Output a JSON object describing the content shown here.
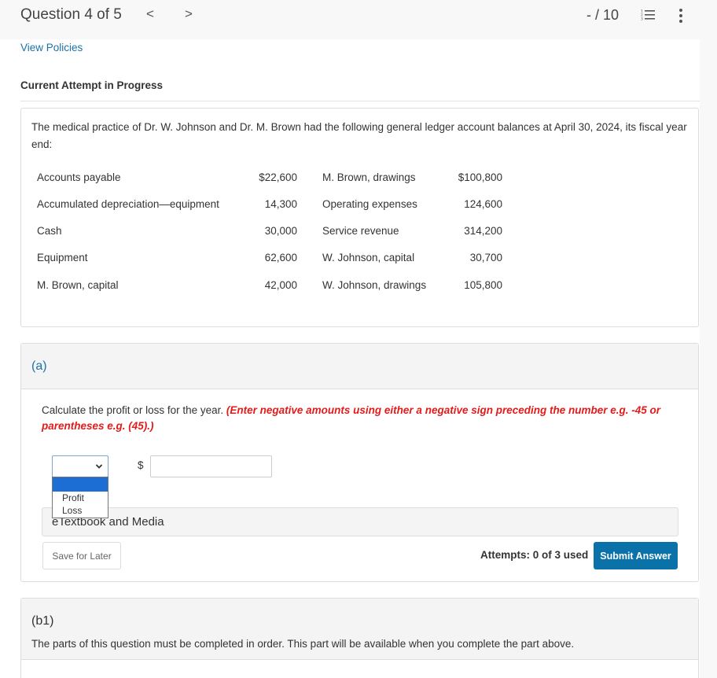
{
  "header": {
    "question_title": "Question 4 of 5",
    "prev_glyph": "<",
    "next_glyph": ">",
    "score": "- / 10",
    "icons": {
      "question_list": "numbered-list-icon",
      "more": "more-vertical-icon"
    }
  },
  "links": {
    "view_policies": "View Policies"
  },
  "attempt_heading": "Current Attempt in Progress",
  "problem": {
    "text": "The medical practice of Dr. W. Johnson and Dr. M. Brown had the following general ledger account balances at April 30, 2024, its fiscal year end:",
    "ledger": [
      {
        "name1": "Accounts payable",
        "amount1": "$22,600",
        "name2": "M. Brown, drawings",
        "amount2": "$100,800"
      },
      {
        "name1": "Accumulated depreciation—equipment",
        "amount1": "14,300",
        "name2": "Operating expenses",
        "amount2": "124,600"
      },
      {
        "name1": "Cash",
        "amount1": "30,000",
        "name2": "Service revenue",
        "amount2": "314,200"
      },
      {
        "name1": "Equipment",
        "amount1": "62,600",
        "name2": "W. Johnson, capital",
        "amount2": "30,700"
      },
      {
        "name1": "M. Brown, capital",
        "amount1": "42,000",
        "name2": "W. Johnson, drawings",
        "amount2": "105,800"
      }
    ]
  },
  "part_a": {
    "label": "(a)",
    "instruction": "Calculate the profit or loss for the year.",
    "instruction_note": "(Enter negative amounts using either a negative sign preceding the number e.g. -45 or parentheses e.g. (45).)",
    "select": {
      "selected": "",
      "options": [
        "",
        "Profit",
        "Loss"
      ]
    },
    "currency_symbol": "$",
    "amount_value": "",
    "etextbook_label": "eTextbook and Media",
    "save_label": "Save for Later",
    "attempts_text": "Attempts: 0 of 3 used",
    "submit_label": "Submit Answer"
  },
  "part_b1": {
    "label": "(b1)",
    "message": "The parts of this question must be completed in order. This part will be available when you complete the part above."
  },
  "colors": {
    "link_blue": "#1a73a8",
    "note_red": "#e21b1b",
    "submit_bg": "#0a72a8",
    "dropdown_highlight": "#1c6ed5"
  }
}
